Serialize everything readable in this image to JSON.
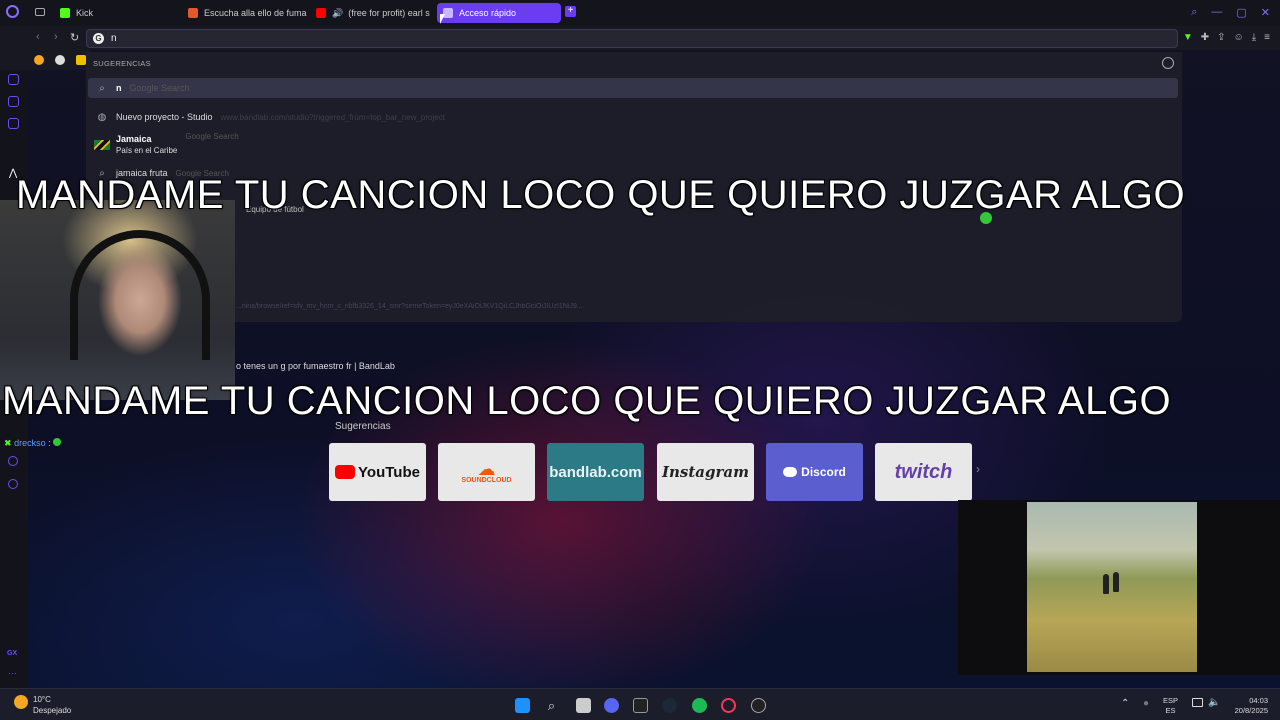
{
  "tabs": [
    {
      "label": "Kick",
      "color": "#53fc18"
    },
    {
      "label": "Escucha alla ello de fuma",
      "color": "#e2592b"
    },
    {
      "label": "(free for profit) earl s",
      "color": "#ff0000"
    },
    {
      "label": "Acceso rápido",
      "color": "#8a6cff",
      "active": true
    }
  ],
  "new_tab_label": "+",
  "omnibox": {
    "value": "n"
  },
  "dropdown": {
    "title": "SUGERENCIAS",
    "search_row": {
      "text": "n",
      "hint": "Google Search"
    },
    "history_row": {
      "title": "Nuevo proyecto - Studio",
      "url": "www.bandlab.com/studio?triggered_from=top_bar_new_project"
    },
    "jamaica_row": {
      "title": "Jamaica",
      "subtitle": "País en el Caribe",
      "hint": "Google Search"
    },
    "fruit_row": {
      "text": "jamaica fruta",
      "hint": "Google Search"
    },
    "faded_result": "Equipo de fútbol",
    "faded_url": "...nina/browse/ref=sfv_mv_hom_c_nbfb3326_14_smr?semeToken=eyJ0eXAiOiJKV1QiLCJhbGciOiJIUzI1NiJ9...",
    "bandlab_result": "o tenes un g por fumaestro fr | BandLab"
  },
  "captions": {
    "top": "MANDAME TU CANCION LOCO QUE QUIERO JUZGAR ALGO",
    "bottom": "MANDAME TU CANCION LOCO QUE QUIERO JUZGAR ALGO"
  },
  "chat": {
    "user": "drecksо",
    "separator": ":"
  },
  "speed_dial": {
    "label": "Sugerencias",
    "tiles": [
      {
        "label": "YouTube"
      },
      {
        "label": "SOUNDCLOUD"
      },
      {
        "label": "bandlab.com"
      },
      {
        "label": "Instagram"
      },
      {
        "label": "Discord"
      },
      {
        "label": "twitch"
      }
    ]
  },
  "taskbar": {
    "weather_temp": "10°C",
    "weather_desc": "Despejado",
    "lang_top": "ESP",
    "lang_bottom": "ES",
    "time": "04:03",
    "date": "20/8/2025",
    "gx_label": "GX"
  }
}
